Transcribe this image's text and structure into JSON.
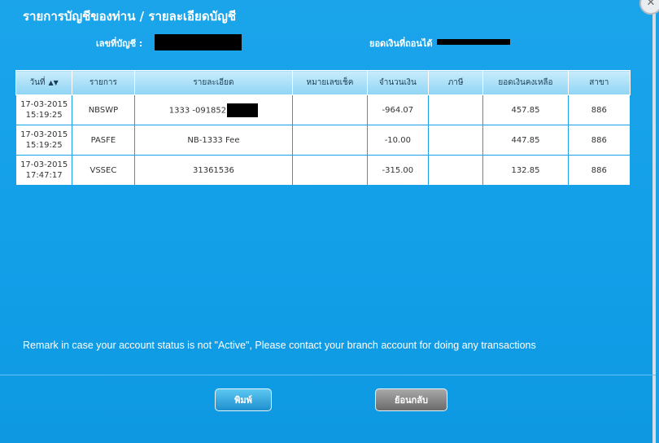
{
  "header": {
    "title": "รายการบัญชีของท่าน / รายละเอียดบัญชี",
    "account_label": "เลขที่บัญชี :",
    "balance_label": "ยอดเงินที่ถอนได้"
  },
  "table": {
    "columns": [
      "วันที่",
      "รายการ",
      "รายละเอียด",
      "หมายเลขเช็ค",
      "จำนวนเงิน",
      "ภาษี",
      "ยอดเงินคงเหลือ",
      "สาขา"
    ],
    "rows": [
      {
        "date": "17-03-2015",
        "time": "15:19:25",
        "code": "NBSWP",
        "detail": "1333 -091852",
        "cheque": "",
        "amount": "-964.07",
        "tax": "",
        "balance": "457.85",
        "branch": "886"
      },
      {
        "date": "17-03-2015",
        "time": "15:19:25",
        "code": "PASFE",
        "detail": "NB-1333 Fee",
        "cheque": "",
        "amount": "-10.00",
        "tax": "",
        "balance": "447.85",
        "branch": "886"
      },
      {
        "date": "17-03-2015",
        "time": "17:47:17",
        "code": "VSSEC",
        "detail": "31361536",
        "cheque": "",
        "amount": "-315.00",
        "tax": "",
        "balance": "132.85",
        "branch": "886"
      }
    ]
  },
  "remark": "Remark in case your account status is not \"Active\", Please contact your branch account for doing any transactions",
  "buttons": {
    "print": "พิมพ์",
    "back": "ย้อนกลับ"
  },
  "icons": {
    "sort": "sort-icon",
    "close": "close-icon"
  },
  "colors": {
    "background": "#1aa0e6",
    "header_row": "#a8dff7",
    "print_button": "#3fb3e6",
    "back_button": "#888888"
  }
}
